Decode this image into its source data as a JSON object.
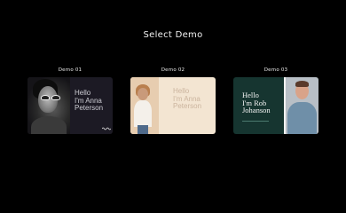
{
  "page": {
    "title": "Select Demo"
  },
  "demos": [
    {
      "label": "Demo 01",
      "card_text": [
        "Hello",
        "I'm Anna",
        "Peterson"
      ]
    },
    {
      "label": "Demo 02",
      "card_text": [
        "Hello",
        "I'm Anna",
        "Peterson"
      ]
    },
    {
      "label": "Demo 03",
      "card_text": [
        "Hello",
        "I'm Rob",
        "Johanson"
      ]
    }
  ],
  "colors": {
    "background": "#000000",
    "demo1_bg": "#1c1a24",
    "demo2_bg": "#f3e5d2",
    "demo3_bg": "#163530"
  }
}
